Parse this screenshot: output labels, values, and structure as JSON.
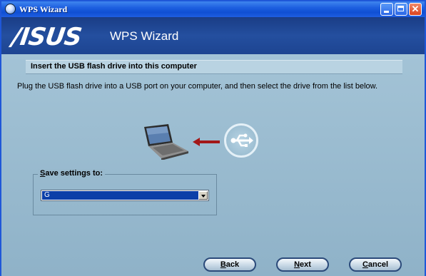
{
  "window": {
    "title": "WPS Wizard"
  },
  "header": {
    "logo_text": "/ISUS",
    "title": "WPS Wizard"
  },
  "section": {
    "title": "Insert the USB flash drive into this computer",
    "instructions": "Plug the USB flash drive into a USB port on your computer, and then select the drive from the list below."
  },
  "illustration": {
    "left_icon": "laptop-icon",
    "middle_icon": "arrow-left-icon",
    "right_icon": "usb-icon"
  },
  "save_group": {
    "label_mnemonic": "S",
    "label_rest": "ave settings to:",
    "selected_drive": "G"
  },
  "buttons": {
    "back_mnemonic": "B",
    "back_rest": "ack",
    "next_mnemonic": "N",
    "next_rest": "ext",
    "cancel_mnemonic": "C",
    "cancel_rest": "ancel"
  },
  "colors": {
    "titlebar": "#1d5fe0",
    "header": "#1f4a96",
    "content": "#9dbdd1",
    "selection": "#0b3fa8",
    "arrow": "#a31818"
  }
}
